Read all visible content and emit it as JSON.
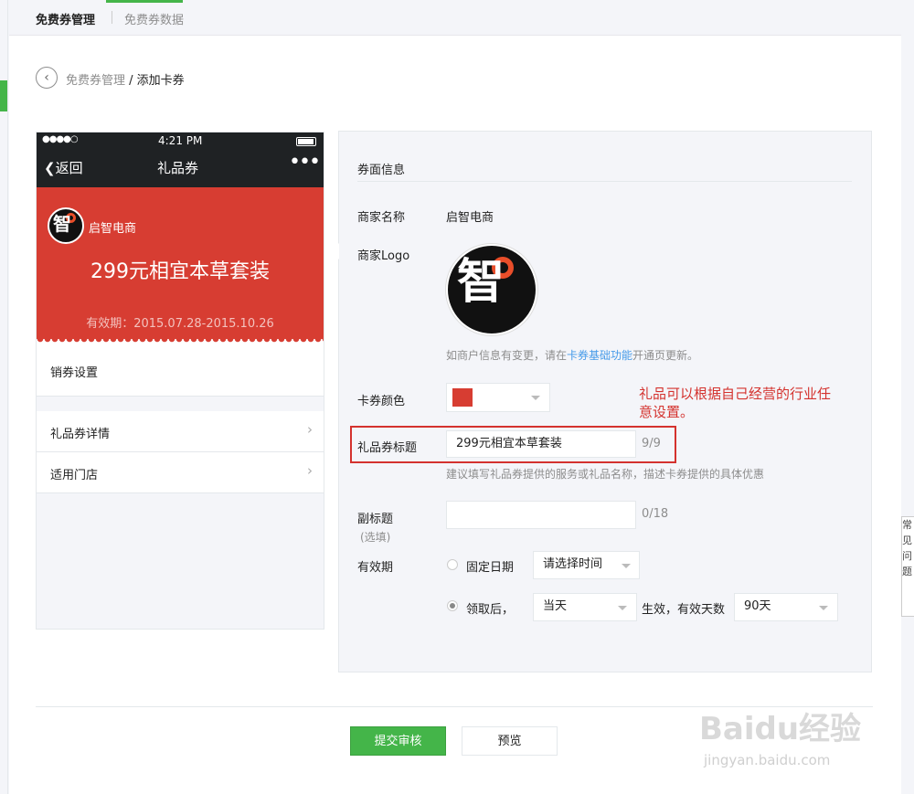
{
  "tabs": [
    {
      "label": "免费券管理"
    },
    {
      "label": "免费券数据"
    }
  ],
  "breadcrumb": {
    "parent": "免费券管理",
    "separator": " / ",
    "current": "添加卡券"
  },
  "phone": {
    "signal": "●●●●○",
    "time": "4:21 PM",
    "back": "返回",
    "title": "礼品券",
    "more": "•••",
    "merchant": "启智电商",
    "card_title": "299元相宜本草套装",
    "validity": "有效期：2015.07.28-2015.10.26",
    "rows": [
      {
        "label": "销券设置"
      },
      {
        "label": "礼品券详情"
      },
      {
        "label": "适用门店"
      }
    ]
  },
  "form": {
    "section_title": "券面信息",
    "merchant_name_label": "商家名称",
    "merchant_name": "启智电商",
    "logo_label": "商家Logo",
    "logo_hint_prefix": "如商户信息有变更，请在",
    "logo_hint_link": "卡券基础功能",
    "logo_hint_suffix": "开通页更新。",
    "color_label": "卡券颜色",
    "card_color": "#d73d32",
    "annotation": "礼品可以根据自己经营的行业任意设置。",
    "title_label": "礼品券标题",
    "title_value": "299元相宜本草套装",
    "title_counter": "9/9",
    "title_hint": "建议填写礼品券提供的服务或礼品名称，描述卡券提供的具体优惠",
    "subtitle_label": "副标题",
    "subtitle_optional": "(选填)",
    "subtitle_value": "",
    "subtitle_counter": "0/18",
    "validity_label": "有效期",
    "fixed_date_label": "固定日期",
    "fixed_date_select": "请选择时间",
    "after_receive_label": "领取后，",
    "after_receive_select": "当天",
    "effective_label": "生效，有效天数",
    "days_select": "90天"
  },
  "buttons": {
    "submit": "提交审核",
    "preview": "预览"
  },
  "side_popup": "常见问题",
  "watermark": {
    "brand": "Baidu经验",
    "url": "jingyan.baidu.com"
  },
  "colors": {
    "accent": "#44b549",
    "card": "#d73d32",
    "highlight": "#d4322e",
    "link": "#459ae9"
  }
}
